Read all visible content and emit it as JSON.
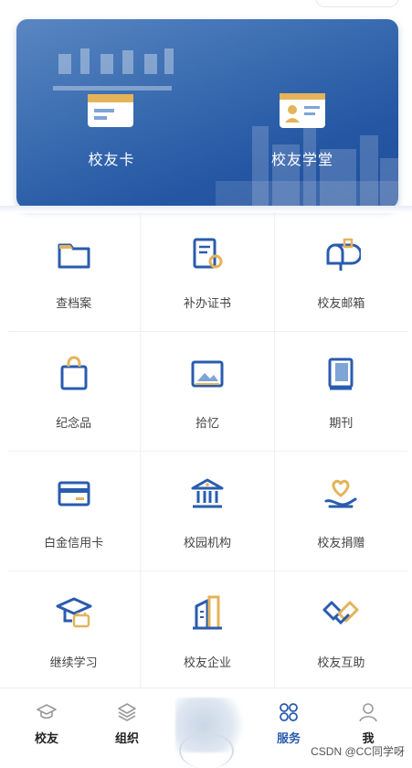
{
  "banner": {
    "items": [
      {
        "label": "校友卡",
        "icon": "card-icon"
      },
      {
        "label": "校友学堂",
        "icon": "id-card-icon"
      }
    ]
  },
  "services": [
    {
      "label": "查档案",
      "icon": "folder-icon"
    },
    {
      "label": "补办证书",
      "icon": "certificate-icon"
    },
    {
      "label": "校友邮箱",
      "icon": "mailbox-icon"
    },
    {
      "label": "纪念品",
      "icon": "shopping-bag-icon"
    },
    {
      "label": "拾忆",
      "icon": "picture-icon"
    },
    {
      "label": "期刊",
      "icon": "journal-icon"
    },
    {
      "label": "白金信用卡",
      "icon": "credit-card-icon"
    },
    {
      "label": "校园机构",
      "icon": "institution-icon"
    },
    {
      "label": "校友捐赠",
      "icon": "donation-heart-icon"
    },
    {
      "label": "继续学习",
      "icon": "graduation-cap-icon"
    },
    {
      "label": "校友企业",
      "icon": "building-icon"
    },
    {
      "label": "校友互助",
      "icon": "handshake-icon"
    }
  ],
  "tabbar": {
    "items": [
      {
        "label": "校友",
        "icon": "mortarboard-icon",
        "active": false
      },
      {
        "label": "组织",
        "icon": "layers-icon",
        "active": false
      },
      {
        "label": "服务",
        "icon": "grid-icon",
        "active": true
      },
      {
        "label": "我",
        "icon": "user-icon",
        "active": false
      }
    ]
  },
  "watermark": "CSDN @CC同学呀",
  "colors": {
    "primary": "#2a5cae",
    "accent": "#e4b35a",
    "banner": "#2557a4"
  }
}
